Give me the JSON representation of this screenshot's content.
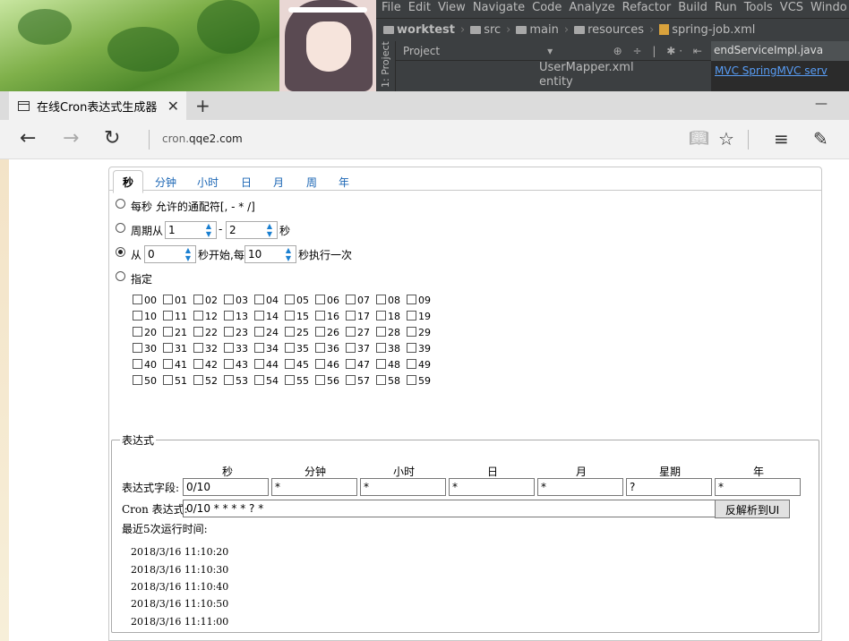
{
  "ide": {
    "menu": [
      "File",
      "Edit",
      "View",
      "Navigate",
      "Code",
      "Analyze",
      "Refactor",
      "Build",
      "Run",
      "Tools",
      "VCS",
      "Windo"
    ],
    "breadcrumbs": [
      "worktest",
      "src",
      "main",
      "resources",
      "spring-job.xml"
    ],
    "project_label": "Project",
    "side_label": "1: Project",
    "tree": [
      "UserMapper.xml",
      "entity"
    ],
    "editor_tab": "endServiceImpl.java",
    "editor_link": "MVC SpringMVC serv"
  },
  "browser": {
    "tab_title": "在线Cron表达式生成器",
    "new_tab": "+",
    "close_tab": "✕",
    "minimize": "—",
    "address_prefix": "cron.",
    "address_domain": "qqe2.com"
  },
  "cron": {
    "tabs": [
      "秒",
      "分钟",
      "小时",
      "日",
      "月",
      "周",
      "年"
    ],
    "option_every": "每秒 允许的通配符[, - * /]",
    "option_cycle_prefix": "周期从",
    "cycle_from": "1",
    "cycle_dash": "-",
    "cycle_to": "2",
    "cycle_suffix": "秒",
    "option_from_prefix": "从",
    "from_start": "0",
    "from_mid": "秒开始,每",
    "from_every": "10",
    "from_suffix": "秒执行一次",
    "option_specify": "指定",
    "selected_option": "从",
    "checkbox_rows": [
      [
        "00",
        "01",
        "02",
        "03",
        "04",
        "05",
        "06",
        "07",
        "08",
        "09"
      ],
      [
        "10",
        "11",
        "12",
        "13",
        "14",
        "15",
        "16",
        "17",
        "18",
        "19"
      ],
      [
        "20",
        "21",
        "22",
        "23",
        "24",
        "25",
        "26",
        "27",
        "28",
        "29"
      ],
      [
        "30",
        "31",
        "32",
        "33",
        "34",
        "35",
        "36",
        "37",
        "38",
        "39"
      ],
      [
        "40",
        "41",
        "42",
        "43",
        "44",
        "45",
        "46",
        "47",
        "48",
        "49"
      ],
      [
        "50",
        "51",
        "52",
        "53",
        "54",
        "55",
        "56",
        "57",
        "58",
        "59"
      ]
    ]
  },
  "expression": {
    "legend": "表达式",
    "columns": [
      "秒",
      "分钟",
      "小时",
      "日",
      "月",
      "星期",
      "年"
    ],
    "field_label": "表达式字段:",
    "fields": [
      "0/10",
      "*",
      "*",
      "*",
      "*",
      "?",
      "*"
    ],
    "cron_label": "Cron 表达式:",
    "cron_value": "0/10 * * * * ? *",
    "parse_button": "反解析到UI",
    "recent_label": "最近5次运行时间:",
    "run_times": [
      "2018/3/16 11:10:20",
      "2018/3/16 11:10:30",
      "2018/3/16 11:10:40",
      "2018/3/16 11:10:50",
      "2018/3/16 11:11:00"
    ]
  }
}
